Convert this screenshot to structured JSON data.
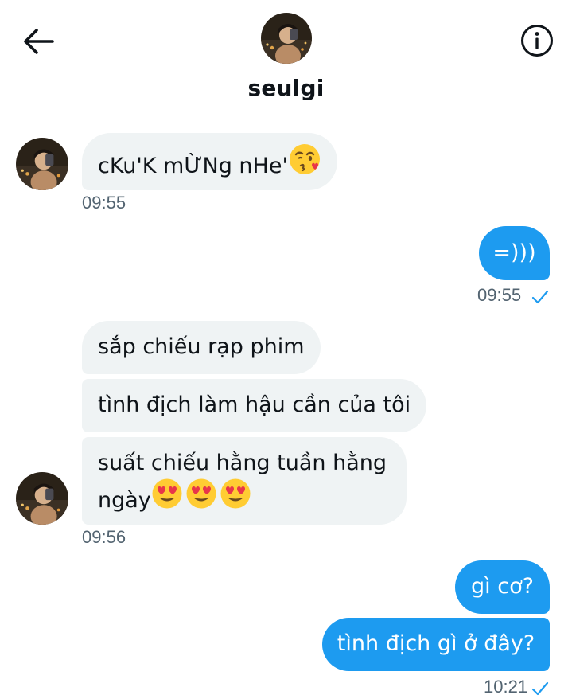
{
  "header": {
    "name": "seulgi",
    "back_icon": "arrow-left-icon",
    "info_icon": "info-circle-icon"
  },
  "colors": {
    "outgoing_bubble": "#1d9bf0",
    "incoming_bubble": "#eff3f4",
    "timestamp": "#536471",
    "check": "#1d9bf0"
  },
  "messages": [
    {
      "direction": "incoming",
      "text": "cKu'K mỪNg nHe'",
      "emoji": "face-blowing-kiss-emoji"
    },
    {
      "direction": "incoming",
      "time": "09:55"
    },
    {
      "direction": "outgoing",
      "text": "=)))"
    },
    {
      "direction": "outgoing",
      "time": "09:55",
      "status": "sent-check-icon"
    },
    {
      "direction": "incoming",
      "text": "sắp chiếu rạp phim"
    },
    {
      "direction": "incoming",
      "text": "tình địch làm hậu cần của tôi"
    },
    {
      "direction": "incoming",
      "text_line1": "suất chiếu hằng tuần hằng",
      "text_line2": "ngày",
      "emoji": "heart-eyes-emoji"
    },
    {
      "direction": "incoming",
      "time": "09:56"
    },
    {
      "direction": "outgoing",
      "text": "gì cơ?"
    },
    {
      "direction": "outgoing",
      "text": "tình địch gì ở đây?"
    },
    {
      "direction": "outgoing",
      "time": "10:21",
      "status": "sent-check-icon"
    }
  ]
}
